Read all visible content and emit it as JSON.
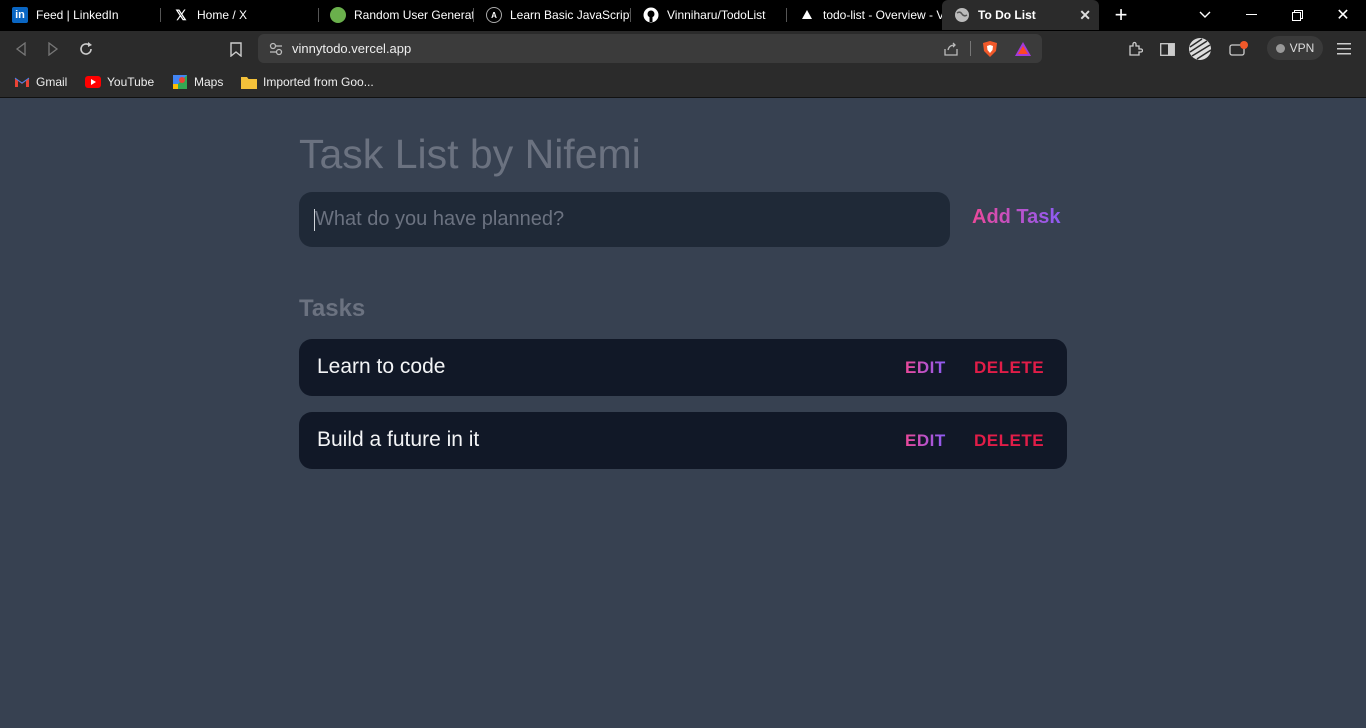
{
  "browser": {
    "tabs": [
      {
        "title": "Feed | LinkedIn",
        "icon": "linkedin-icon"
      },
      {
        "title": "Home / X",
        "icon": "x-icon"
      },
      {
        "title": "Random User Generat",
        "icon": "random-user-icon"
      },
      {
        "title": "Learn Basic JavaScript",
        "icon": "js-course-icon"
      },
      {
        "title": "Vinniharu/TodoList",
        "icon": "github-icon"
      },
      {
        "title": "todo-list - Overview - V",
        "icon": "vercel-icon"
      },
      {
        "title": "To Do List",
        "icon": "globe-icon",
        "active": true
      }
    ],
    "url": "vinnytodo.vercel.app",
    "vpn_label": "VPN",
    "bookmarks": [
      {
        "label": "Gmail",
        "icon": "gmail-icon"
      },
      {
        "label": "YouTube",
        "icon": "youtube-icon"
      },
      {
        "label": "Maps",
        "icon": "maps-icon"
      },
      {
        "label": "Imported from Goo...",
        "icon": "folder-icon"
      }
    ]
  },
  "app": {
    "title": "Task List by Nifemi",
    "input_placeholder": "What do you have planned?",
    "add_label": "Add Task",
    "section_title": "Tasks",
    "tasks": [
      {
        "text": "Learn to code",
        "edit_label": "EDIT",
        "delete_label": "DELETE"
      },
      {
        "text": "Build a future in it",
        "edit_label": "EDIT",
        "delete_label": "DELETE"
      }
    ]
  },
  "colors": {
    "page_bg": "#374151",
    "card_bg": "#111827",
    "input_bg": "#1f2937",
    "accent_gradient": [
      "#ec4899",
      "#8b5cf6"
    ],
    "delete": "#e11d48"
  }
}
